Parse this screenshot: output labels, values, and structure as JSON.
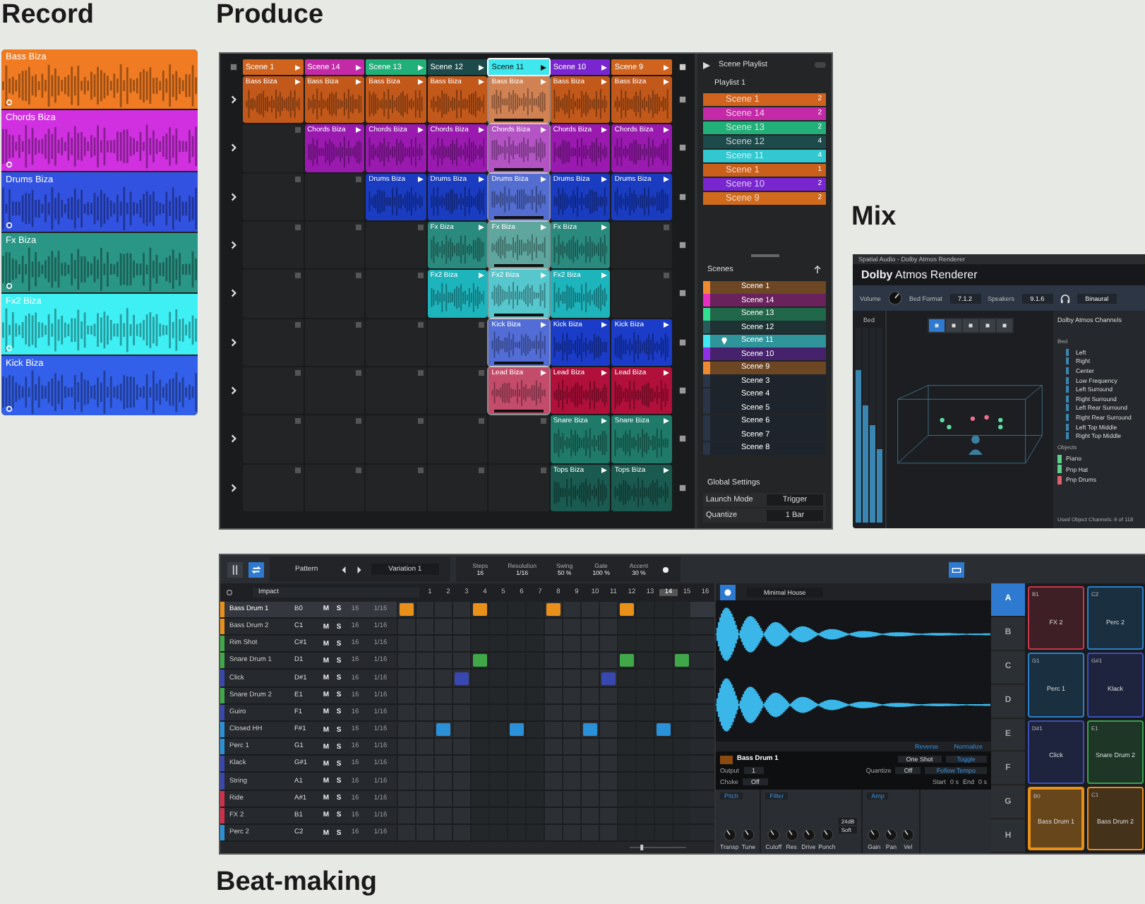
{
  "record": {
    "heading": "Record",
    "tracks": [
      {
        "name": "Bass Biza",
        "color": "#f07b22"
      },
      {
        "name": "Chords Biza",
        "color": "#d030e0"
      },
      {
        "name": "Drums Biza",
        "color": "#3252e2"
      },
      {
        "name": "Fx Biza",
        "color": "#2a9686"
      },
      {
        "name": "Fx2 Biza",
        "color": "#3ef0f4"
      },
      {
        "name": "Kick Biza",
        "color": "#3360ea"
      }
    ]
  },
  "produce": {
    "heading": "Produce",
    "scenes": [
      {
        "label": "Scene 1",
        "color": "#d0641e",
        "selected": false
      },
      {
        "label": "Scene 14",
        "color": "#c42aa8",
        "selected": false
      },
      {
        "label": "Scene 13",
        "color": "#22b07a",
        "selected": false
      },
      {
        "label": "Scene 12",
        "color": "#1d4a4a",
        "selected": false
      },
      {
        "label": "Scene 11",
        "color": "#3ee8ee",
        "selected": true
      },
      {
        "label": "Scene 10",
        "color": "#7a26d0",
        "selected": false
      },
      {
        "label": "Scene 9",
        "color": "#d0641e",
        "selected": false
      }
    ],
    "tracks": [
      {
        "color": "#c2581a",
        "slots": [
          {
            "kind": "clip",
            "label": "Bass Biza",
            "playing": false
          },
          {
            "kind": "clip",
            "label": "Bass Biza",
            "playing": false
          },
          {
            "kind": "clip",
            "label": "Bass Biza",
            "playing": false
          },
          {
            "kind": "clip",
            "label": "Bass Biza",
            "playing": false
          },
          {
            "kind": "clip",
            "label": "Bass Biza",
            "playing": true
          },
          {
            "kind": "clip",
            "label": "Bass Biza",
            "playing": false
          },
          {
            "kind": "clip",
            "label": "Bass Biza",
            "playing": false
          }
        ]
      },
      {
        "color": "#9a1ab0",
        "slots": [
          {
            "kind": "empty"
          },
          {
            "kind": "clip",
            "label": "Chords Biza",
            "playing": false
          },
          {
            "kind": "clip",
            "label": "Chords Biza",
            "playing": false
          },
          {
            "kind": "clip",
            "label": "Chords Biza",
            "playing": false
          },
          {
            "kind": "clip",
            "label": "Chords Biza",
            "playing": true
          },
          {
            "kind": "clip",
            "label": "Chords Biza",
            "playing": false
          },
          {
            "kind": "clip",
            "label": "Chords Biza",
            "playing": false
          }
        ]
      },
      {
        "color": "#1a3cc0",
        "slots": [
          {
            "kind": "empty"
          },
          {
            "kind": "empty"
          },
          {
            "kind": "clip",
            "label": "Drums Biza",
            "playing": false
          },
          {
            "kind": "clip",
            "label": "Drums Biza",
            "playing": false
          },
          {
            "kind": "clip",
            "label": "Drums Biza",
            "playing": true
          },
          {
            "kind": "clip",
            "label": "Drums Biza",
            "playing": false
          },
          {
            "kind": "clip",
            "label": "Drums Biza",
            "playing": false
          }
        ]
      },
      {
        "color": "#2a8a7e",
        "slots": [
          {
            "kind": "empty"
          },
          {
            "kind": "empty"
          },
          {
            "kind": "empty"
          },
          {
            "kind": "clip",
            "label": "Fx Biza",
            "playing": false
          },
          {
            "kind": "clip",
            "label": "Fx Biza",
            "playing": true
          },
          {
            "kind": "clip",
            "label": "Fx Biza",
            "playing": false
          },
          {
            "kind": "empty"
          }
        ]
      },
      {
        "color": "#1eb4bc",
        "slots": [
          {
            "kind": "empty"
          },
          {
            "kind": "empty"
          },
          {
            "kind": "empty"
          },
          {
            "kind": "clip",
            "label": "Fx2 Biza",
            "playing": false
          },
          {
            "kind": "clip",
            "label": "Fx2 Biza",
            "playing": true
          },
          {
            "kind": "clip",
            "label": "Fx2 Biza",
            "playing": false
          },
          {
            "kind": "empty"
          }
        ]
      },
      {
        "color": "#1a3cc8",
        "slots": [
          {
            "kind": "empty"
          },
          {
            "kind": "empty"
          },
          {
            "kind": "empty"
          },
          {
            "kind": "empty"
          },
          {
            "kind": "clip",
            "label": "Kick Biza",
            "playing": true
          },
          {
            "kind": "clip",
            "label": "Kick Biza",
            "playing": false
          },
          {
            "kind": "clip",
            "label": "Kick Biza",
            "playing": false
          }
        ]
      },
      {
        "color": "#b0103a",
        "slots": [
          {
            "kind": "empty"
          },
          {
            "kind": "empty"
          },
          {
            "kind": "empty"
          },
          {
            "kind": "empty"
          },
          {
            "kind": "clip",
            "label": "Lead Biza",
            "playing": true
          },
          {
            "kind": "clip",
            "label": "Lead Biza",
            "playing": false
          },
          {
            "kind": "clip",
            "label": "Lead Biza",
            "playing": false
          }
        ]
      },
      {
        "color": "#1f7a6a",
        "slots": [
          {
            "kind": "empty"
          },
          {
            "kind": "empty"
          },
          {
            "kind": "empty"
          },
          {
            "kind": "empty"
          },
          {
            "kind": "empty"
          },
          {
            "kind": "clip",
            "label": "Snare Biza",
            "playing": false
          },
          {
            "kind": "clip",
            "label": "Snare Biza",
            "playing": false
          }
        ]
      },
      {
        "color": "#1a5a50",
        "slots": [
          {
            "kind": "empty"
          },
          {
            "kind": "empty"
          },
          {
            "kind": "empty"
          },
          {
            "kind": "empty"
          },
          {
            "kind": "empty"
          },
          {
            "kind": "clip",
            "label": "Tops Biza",
            "playing": false
          },
          {
            "kind": "clip",
            "label": "Tops Biza",
            "playing": false
          }
        ]
      }
    ],
    "playlist": {
      "title": "Scene Playlist",
      "name": "Playlist 1",
      "items": [
        {
          "label": "Scene 1",
          "count": "2",
          "color": "#d0641e"
        },
        {
          "label": "Scene 14",
          "count": "2",
          "color": "#c42aa8"
        },
        {
          "label": "Scene 13",
          "count": "2",
          "color": "#22b07a"
        },
        {
          "label": "Scene 12",
          "count": "4",
          "color": "#1d4a4a"
        },
        {
          "label": "Scene 11",
          "count": "4",
          "color": "#32c8d0"
        },
        {
          "label": "Scene 1",
          "count": "1",
          "color": "#c8601c"
        },
        {
          "label": "Scene 10",
          "count": "2",
          "color": "#7a26d0"
        },
        {
          "label": "Scene 9",
          "count": "2",
          "color": "#d06a1c"
        }
      ]
    },
    "scene_list": {
      "title": "Scenes",
      "items": [
        {
          "label": "Scene 1",
          "color": "#f08a30",
          "selected": false
        },
        {
          "label": "Scene 14",
          "color": "#e830c0",
          "selected": false
        },
        {
          "label": "Scene 13",
          "color": "#30e090",
          "selected": false
        },
        {
          "label": "Scene 12",
          "color": "#2a5a5a",
          "selected": false
        },
        {
          "label": "Scene 11",
          "color": "#40e8f0",
          "selected": true
        },
        {
          "label": "Scene 10",
          "color": "#9030e8",
          "selected": false
        },
        {
          "label": "Scene 9",
          "color": "#f08a30",
          "selected": false
        },
        {
          "label": "Scene 3",
          "color": "#2a3548",
          "selected": false
        },
        {
          "label": "Scene 4",
          "color": "#2a3548",
          "selected": false
        },
        {
          "label": "Scene 5",
          "color": "#2a3548",
          "selected": false
        },
        {
          "label": "Scene 6",
          "color": "#2a3548",
          "selected": false
        },
        {
          "label": "Scene 7",
          "color": "#2a3548",
          "selected": false
        },
        {
          "label": "Scene 8",
          "color": "#2a3548",
          "selected": false
        }
      ]
    },
    "global_settings": {
      "title": "Global Settings",
      "fields": [
        {
          "label": "Launch Mode",
          "value": "Trigger"
        },
        {
          "label": "Quantize",
          "value": "1 Bar"
        }
      ]
    }
  },
  "mix": {
    "heading": "Mix",
    "window_title": "Spatial Audio - Dolby Atmos Renderer",
    "logo": "**Dolby** Atmos Renderer",
    "volume_label": "Volume",
    "fields": [
      {
        "label": "Bed Format",
        "value": "7.1.2"
      },
      {
        "label": "Speakers",
        "value": "9.1.6"
      }
    ],
    "monitor": "Binaural",
    "meter_label": "Bed",
    "meters": [
      {
        "level": 0.78
      },
      {
        "level": 0.6
      },
      {
        "level": 0.5
      },
      {
        "level": 0.38
      }
    ],
    "channels_title": "Dolby Atmos Channels",
    "bed_label": "Bed",
    "channels": [
      "Left",
      "Right",
      "Center",
      "Low Frequency",
      "Left Surround",
      "Right Surround",
      "Left Rear Surround",
      "Right Rear Surround",
      "Left Top Middle",
      "Right Top Middle"
    ],
    "objects_label": "Objects",
    "objects": [
      {
        "name": "Piano",
        "color": "#5fd08a"
      },
      {
        "name": "Pnp Hat",
        "color": "#5fd08a"
      },
      {
        "name": "Pnp Drums",
        "color": "#e06070"
      }
    ],
    "footer": "Used Object Channels: 6 of 118"
  },
  "beat": {
    "heading": "Beat-making",
    "toolbar": {
      "pattern": "Pattern",
      "variation": "Variation 1",
      "params": [
        {
          "label": "Steps",
          "value": "16"
        },
        {
          "label": "Resolution",
          "value": "1/16"
        },
        {
          "label": "Swing",
          "value": "50 %"
        },
        {
          "label": "Gate",
          "value": "100 %"
        },
        {
          "label": "Accent",
          "value": "30 %"
        }
      ]
    },
    "kit": "Impact",
    "steps": [
      {
        "label": "1",
        "selected": false
      },
      {
        "label": "2",
        "selected": false
      },
      {
        "label": "3",
        "selected": false
      },
      {
        "label": "4",
        "selected": false
      },
      {
        "label": "5",
        "selected": false
      },
      {
        "label": "6",
        "selected": false
      },
      {
        "label": "7",
        "selected": false
      },
      {
        "label": "8",
        "selected": false
      },
      {
        "label": "9",
        "selected": false
      },
      {
        "label": "10",
        "selected": false
      },
      {
        "label": "11",
        "selected": false
      },
      {
        "label": "12",
        "selected": false
      },
      {
        "label": "13",
        "selected": false
      },
      {
        "label": "14",
        "selected": true
      },
      {
        "label": "15",
        "selected": false
      },
      {
        "label": "16",
        "selected": false
      }
    ],
    "rows": [
      {
        "name": "Bass Drum 1",
        "note": "B0",
        "color": "#e8901a",
        "selected": true,
        "mute": "M",
        "solo": "S",
        "length": "16",
        "resolution": "1/16",
        "hits": [
          true,
          false,
          false,
          false,
          true,
          false,
          false,
          false,
          true,
          false,
          false,
          false,
          true,
          false,
          false,
          false
        ]
      },
      {
        "name": "Bass Drum 2",
        "note": "C1",
        "color": "#e8901a",
        "selected": false,
        "mute": "M",
        "solo": "S",
        "length": "16",
        "resolution": "1/16",
        "hits": [
          false,
          false,
          false,
          false,
          false,
          false,
          false,
          false,
          false,
          false,
          false,
          false,
          false,
          false,
          false,
          false
        ]
      },
      {
        "name": "Rim Shot",
        "note": "C#1",
        "color": "#40a848",
        "selected": false,
        "mute": "M",
        "solo": "S",
        "length": "16",
        "resolution": "1/16",
        "hits": [
          false,
          false,
          false,
          false,
          false,
          false,
          false,
          false,
          false,
          false,
          false,
          false,
          false,
          false,
          false,
          false
        ]
      },
      {
        "name": "Snare Drum 1",
        "note": "D1",
        "color": "#40a848",
        "selected": false,
        "mute": "M",
        "solo": "S",
        "length": "16",
        "resolution": "1/16",
        "hits": [
          false,
          false,
          false,
          false,
          true,
          false,
          false,
          false,
          false,
          false,
          false,
          false,
          true,
          false,
          false,
          true
        ]
      },
      {
        "name": "Click",
        "note": "D#1",
        "color": "#3848b0",
        "selected": false,
        "mute": "M",
        "solo": "S",
        "length": "16",
        "resolution": "1/16",
        "hits": [
          false,
          false,
          false,
          true,
          false,
          false,
          false,
          false,
          false,
          false,
          false,
          true,
          false,
          false,
          false,
          false
        ]
      },
      {
        "name": "Snare Drum 2",
        "note": "E1",
        "color": "#40a848",
        "selected": false,
        "mute": "M",
        "solo": "S",
        "length": "16",
        "resolution": "1/16",
        "hits": [
          false,
          false,
          false,
          false,
          false,
          false,
          false,
          false,
          false,
          false,
          false,
          false,
          false,
          false,
          false,
          false
        ]
      },
      {
        "name": "Guiro",
        "note": "F1",
        "color": "#3848b0",
        "selected": false,
        "mute": "M",
        "solo": "S",
        "length": "16",
        "resolution": "1/16",
        "hits": [
          false,
          false,
          false,
          false,
          false,
          false,
          false,
          false,
          false,
          false,
          false,
          false,
          false,
          false,
          false,
          false
        ]
      },
      {
        "name": "Closed HH",
        "note": "F#1",
        "color": "#2a90d8",
        "selected": false,
        "mute": "M",
        "solo": "S",
        "length": "16",
        "resolution": "1/16",
        "hits": [
          false,
          false,
          true,
          false,
          false,
          false,
          true,
          false,
          false,
          false,
          true,
          false,
          false,
          false,
          true,
          false
        ]
      },
      {
        "name": "Perc 1",
        "note": "G1",
        "color": "#2a90d8",
        "selected": false,
        "mute": "M",
        "solo": "S",
        "length": "16",
        "resolution": "1/16",
        "hits": [
          false,
          false,
          false,
          false,
          false,
          false,
          false,
          false,
          false,
          false,
          false,
          false,
          false,
          false,
          false,
          false
        ]
      },
      {
        "name": "Klack",
        "note": "G#1",
        "color": "#3848b0",
        "selected": false,
        "mute": "M",
        "solo": "S",
        "length": "16",
        "resolution": "1/16",
        "hits": [
          false,
          false,
          false,
          false,
          false,
          false,
          false,
          false,
          false,
          false,
          false,
          false,
          false,
          false,
          false,
          false
        ]
      },
      {
        "name": "String",
        "note": "A1",
        "color": "#3848b0",
        "selected": false,
        "mute": "M",
        "solo": "S",
        "length": "16",
        "resolution": "1/16",
        "hits": [
          false,
          false,
          false,
          false,
          false,
          false,
          false,
          false,
          false,
          false,
          false,
          false,
          false,
          false,
          false,
          false
        ]
      },
      {
        "name": "Ride",
        "note": "A#1",
        "color": "#d0304a",
        "selected": false,
        "mute": "M",
        "solo": "S",
        "length": "16",
        "resolution": "1/16",
        "hits": [
          false,
          false,
          false,
          false,
          false,
          false,
          false,
          false,
          false,
          false,
          false,
          false,
          false,
          false,
          false,
          false
        ]
      },
      {
        "name": "FX 2",
        "note": "B1",
        "color": "#d0304a",
        "selected": false,
        "mute": "M",
        "solo": "S",
        "length": "16",
        "resolution": "1/16",
        "hits": [
          false,
          false,
          false,
          false,
          false,
          false,
          false,
          false,
          false,
          false,
          false,
          false,
          false,
          false,
          false,
          false
        ]
      },
      {
        "name": "Perc 2",
        "note": "C2",
        "color": "#2a90d8",
        "selected": false,
        "mute": "M",
        "solo": "S",
        "length": "16",
        "resolution": "1/16",
        "hits": [
          false,
          false,
          false,
          false,
          false,
          false,
          false,
          false,
          false,
          false,
          false,
          false,
          false,
          false,
          false,
          false
        ]
      }
    ],
    "sampler": {
      "preset": "Minimal House",
      "buttons": [
        "Reverse",
        "Normalize"
      ],
      "sample": "Bass Drum 1",
      "mode": "One Shot",
      "toggle": "Toggle",
      "settings": [
        {
          "label": "Output",
          "value": "1"
        },
        {
          "label": "Quantize",
          "value": "Off"
        },
        {
          "label": "Choke",
          "value": "Off"
        }
      ],
      "follow": "Follow Tempo",
      "start_label": "Start",
      "start": "0 s",
      "end_label": "End",
      "end": "0 s",
      "sections": [
        {
          "title": "Pitch",
          "knobs": [
            "Transp",
            "Tune"
          ]
        },
        {
          "title": "Filter",
          "knobs": [
            "Cutoff",
            "Res",
            "Drive",
            "Punch"
          ],
          "options": [
            "24dB",
            "Soft"
          ]
        },
        {
          "title": "Amp",
          "knobs": [
            "Gain",
            "Pan",
            "Vel"
          ]
        }
      ]
    },
    "zoom": {
      "level": 0.2
    },
    "banks": [
      {
        "label": "A",
        "selected": true
      },
      {
        "label": "B",
        "selected": false
      },
      {
        "label": "C",
        "selected": false
      },
      {
        "label": "D",
        "selected": false
      },
      {
        "label": "E",
        "selected": false
      },
      {
        "label": "F",
        "selected": false
      },
      {
        "label": "G",
        "selected": false
      },
      {
        "label": "H",
        "selected": false
      }
    ],
    "pads": [
      {
        "note": "B1",
        "name": "FX 2",
        "color": "#c8384a",
        "selected": false
      },
      {
        "note": "C2",
        "name": "Perc 2",
        "color": "#2a80c8",
        "selected": false
      },
      {
        "note": "G1",
        "name": "Perc 1",
        "color": "#2a80c8",
        "selected": false
      },
      {
        "note": "G#1",
        "name": "Klack",
        "color": "#3a50b8",
        "selected": false
      },
      {
        "note": "D#1",
        "name": "Click",
        "color": "#3a50b8",
        "selected": false
      },
      {
        "note": "E1",
        "name": "Snare Drum 2",
        "color": "#3aa050",
        "selected": false
      },
      {
        "note": "B0",
        "name": "Bass Drum 1",
        "color": "#e8901a",
        "selected": true
      },
      {
        "note": "C1",
        "name": "Bass Drum 2",
        "color": "#e8901a",
        "selected": false
      }
    ]
  }
}
